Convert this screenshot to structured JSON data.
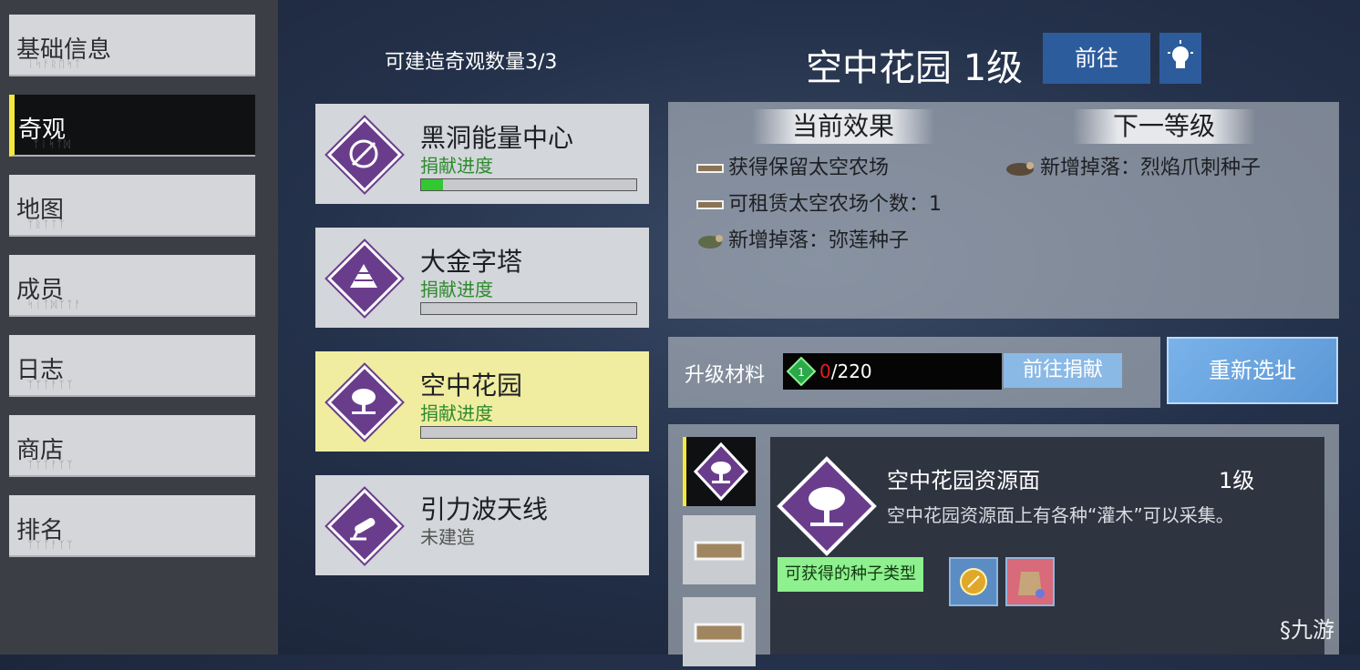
{
  "nav": {
    "items": [
      {
        "label": "基础信息",
        "active": false
      },
      {
        "label": "奇观",
        "active": true
      },
      {
        "label": "地图",
        "active": false
      },
      {
        "label": "成员",
        "active": false
      },
      {
        "label": "日志",
        "active": false
      },
      {
        "label": "商店",
        "active": false
      },
      {
        "label": "排名",
        "active": false
      }
    ]
  },
  "wonders": {
    "build_count": "可建造奇观数量3/3",
    "list": [
      {
        "name": "黑洞能量中心",
        "status": "捐献进度",
        "progress": 0.1,
        "icon": "no-orbit-icon"
      },
      {
        "name": "大金字塔",
        "status": "捐献进度",
        "progress": 0.0,
        "icon": "pyramid-icon"
      },
      {
        "name": "空中花园",
        "status": "捐献进度",
        "progress": 0.0,
        "icon": "tree-icon"
      },
      {
        "name": "引力波天线",
        "status": "未建造",
        "icon": "antenna-icon"
      }
    ]
  },
  "detail": {
    "title": "空中花园 1级",
    "goto_label": "前往",
    "current_effect_header": "当前效果",
    "next_level_header": "下一等级",
    "current_effects": [
      "获得保留太空农场",
      "可租赁太空农场个数：1",
      "新增掉落：弥莲种子"
    ],
    "next_effects": [
      "新增掉落：烈焰爪刺种子"
    ],
    "upgrade_label": "升级材料",
    "material_have": "0",
    "material_need": "/220",
    "donate_label": "前往捐献",
    "relocate_label": "重新选址"
  },
  "resource": {
    "name": "空中花园资源面",
    "level": "1级",
    "description": "空中花园资源面上有各种“灌木”可以采集。",
    "seed_label": "可获得的种子类型"
  },
  "watermark": "九游",
  "colors": {
    "accent_yellow": "#f5e83a",
    "wonder_purple": "#6a3d8c",
    "button_blue": "#2d5c9c",
    "progress_green": "#32c832"
  }
}
